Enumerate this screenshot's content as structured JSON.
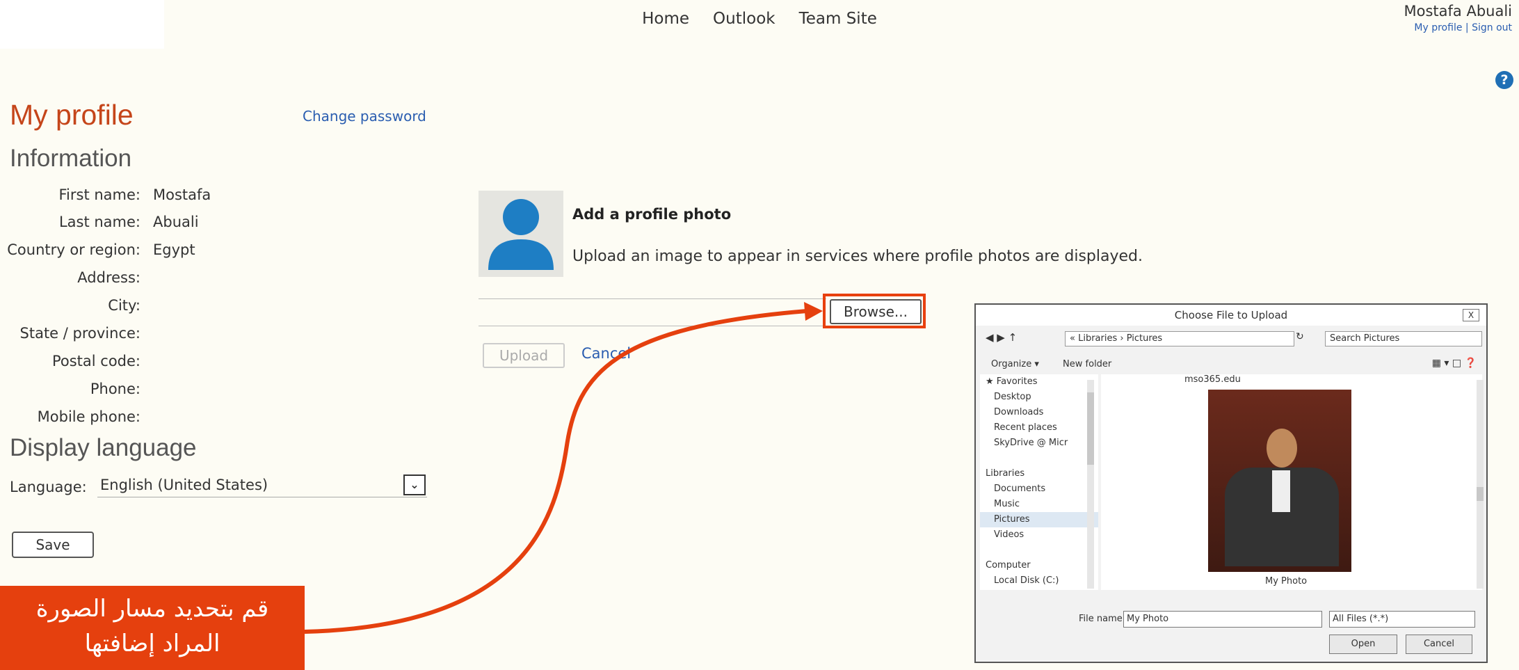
{
  "topnav": {
    "items": [
      "Home",
      "Outlook",
      "Team Site"
    ]
  },
  "user": {
    "name": "Mostafa Abuali",
    "my_profile": "My profile",
    "sep": "|",
    "sign_out": "Sign out"
  },
  "help_icon": "?",
  "page": {
    "title": "My profile",
    "change_password": "Change password"
  },
  "information": {
    "heading": "Information",
    "fields": [
      {
        "label": "First name:",
        "value": "Mostafa"
      },
      {
        "label": "Last name:",
        "value": "Abuali"
      },
      {
        "label": "Country or region:",
        "value": "Egypt"
      },
      {
        "label": "Address:",
        "value": ""
      },
      {
        "label": "City:",
        "value": ""
      },
      {
        "label": "State / province:",
        "value": ""
      },
      {
        "label": "Postal code:",
        "value": ""
      },
      {
        "label": "Phone:",
        "value": ""
      },
      {
        "label": "Mobile phone:",
        "value": ""
      }
    ]
  },
  "display_language": {
    "heading": "Display language",
    "label": "Language:",
    "value": "English (United States)"
  },
  "save_label": "Save",
  "photo": {
    "heading": "Add a profile photo",
    "description": "Upload an image to appear in services where profile photos are displayed.",
    "browse": "Browse...",
    "upload": "Upload",
    "cancel": "Cancel"
  },
  "callout": {
    "line1": "قم بتحديد مسار الصورة",
    "line2": "المراد إضافتها"
  },
  "dialog": {
    "title": "Choose File to Upload",
    "close": "X",
    "address": "« Libraries › Pictures",
    "search_placeholder": "Search Pictures",
    "organize": "Organize ▾",
    "new_folder": "New folder",
    "tree": [
      {
        "label": "★ Favorites",
        "group": true
      },
      {
        "label": "Desktop",
        "group": false
      },
      {
        "label": "Downloads",
        "group": false
      },
      {
        "label": "Recent places",
        "group": false
      },
      {
        "label": "SkyDrive @ Micr",
        "group": false
      },
      {
        "label": "",
        "group": false
      },
      {
        "label": "Libraries",
        "group": true
      },
      {
        "label": "Documents",
        "group": false
      },
      {
        "label": "Music",
        "group": false
      },
      {
        "label": "Pictures",
        "group": false
      },
      {
        "label": "Videos",
        "group": false
      },
      {
        "label": "",
        "group": false
      },
      {
        "label": "Computer",
        "group": true
      },
      {
        "label": "Local Disk (C:)",
        "group": false
      }
    ],
    "top_filename": "mso365.edu",
    "photo_caption": "My Photo",
    "file_name_label": "File name:",
    "file_name_value": "My Photo",
    "file_type": "All Files (*.*)",
    "open": "Open",
    "cancel": "Cancel"
  },
  "colors": {
    "accent": "#c5451a",
    "callout": "#e5400e",
    "link": "#2a5db0",
    "avatar": "#1e7ec4"
  }
}
